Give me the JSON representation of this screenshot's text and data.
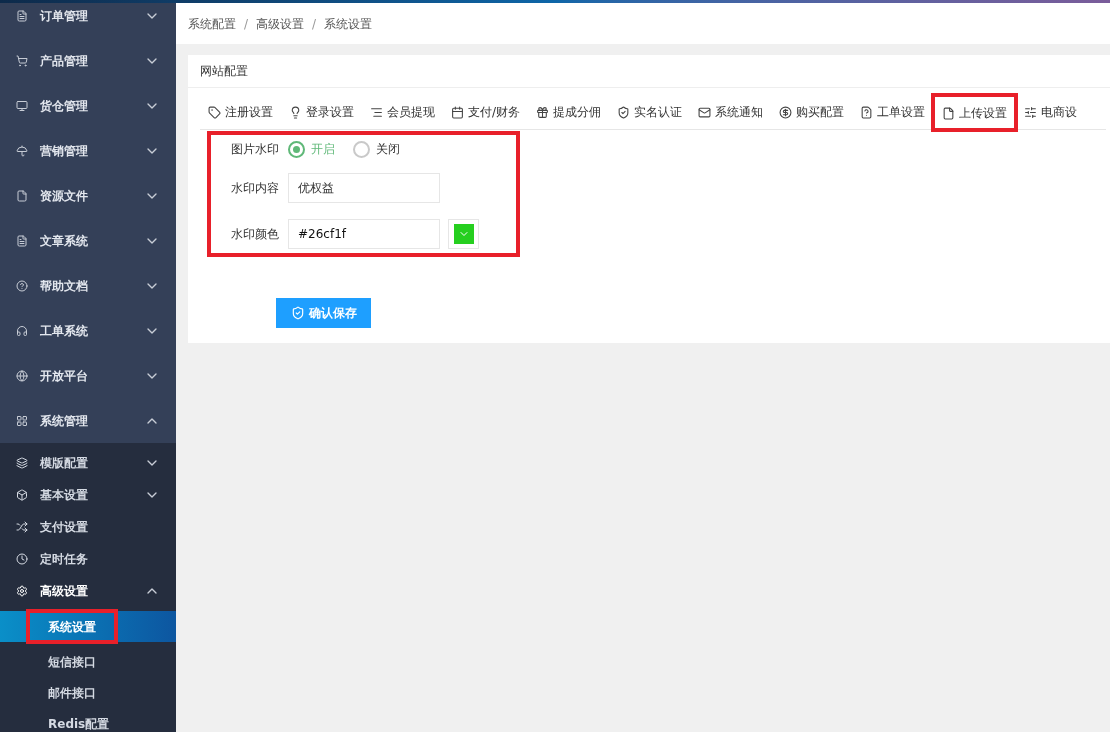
{
  "sidebar": {
    "items": [
      {
        "label": "订单管理",
        "expanded": false
      },
      {
        "label": "产品管理",
        "expanded": false
      },
      {
        "label": "货仓管理",
        "expanded": false
      },
      {
        "label": "营销管理",
        "expanded": false
      },
      {
        "label": "资源文件",
        "expanded": false
      },
      {
        "label": "文章系统",
        "expanded": false
      },
      {
        "label": "帮助文档",
        "expanded": false
      },
      {
        "label": "工单系统",
        "expanded": false
      },
      {
        "label": "开放平台",
        "expanded": false
      },
      {
        "label": "系统管理",
        "expanded": true,
        "children": [
          {
            "label": "模版配置",
            "kind": "group",
            "expanded": false
          },
          {
            "label": "基本设置",
            "kind": "group",
            "expanded": false
          },
          {
            "label": "支付设置",
            "kind": "link"
          },
          {
            "label": "定时任务",
            "kind": "link"
          },
          {
            "label": "高级设置",
            "kind": "group",
            "expanded": true,
            "children": [
              {
                "label": "系统设置",
                "selected": true,
                "highlighted": true
              },
              {
                "label": "短信接口",
                "selected": false,
                "highlighted": false
              },
              {
                "label": "邮件接口",
                "selected": false,
                "highlighted": false
              },
              {
                "label": "Redis配置",
                "selected": false,
                "highlighted": false
              }
            ]
          }
        ]
      }
    ]
  },
  "breadcrumb": [
    "系统配置",
    "高级设置",
    "系统设置"
  ],
  "breadcrumb_separator": "/",
  "card": {
    "title": "网站配置",
    "tabs": [
      {
        "label": "注册设置",
        "selected": false,
        "highlighted": false
      },
      {
        "label": "登录设置",
        "selected": false,
        "highlighted": false
      },
      {
        "label": "会员提现",
        "selected": false,
        "highlighted": false
      },
      {
        "label": "支付/财务",
        "selected": false,
        "highlighted": false
      },
      {
        "label": "提成分佣",
        "selected": false,
        "highlighted": false
      },
      {
        "label": "实名认证",
        "selected": false,
        "highlighted": false
      },
      {
        "label": "系统通知",
        "selected": false,
        "highlighted": false
      },
      {
        "label": "购买配置",
        "selected": false,
        "highlighted": false
      },
      {
        "label": "工单设置",
        "selected": false,
        "highlighted": false
      },
      {
        "label": "上传设置",
        "selected": true,
        "highlighted": true
      },
      {
        "label": "电商设",
        "selected": false,
        "highlighted": false
      }
    ],
    "form": {
      "highlighted": true,
      "watermark": {
        "label": "图片水印",
        "options": [
          {
            "label": "开启",
            "selected": true
          },
          {
            "label": "关闭",
            "selected": false
          }
        ]
      },
      "content": {
        "label": "水印内容",
        "value": "优权益"
      },
      "color": {
        "label": "水印颜色",
        "value": "#26cf1f"
      }
    },
    "save_button": "确认保存"
  }
}
